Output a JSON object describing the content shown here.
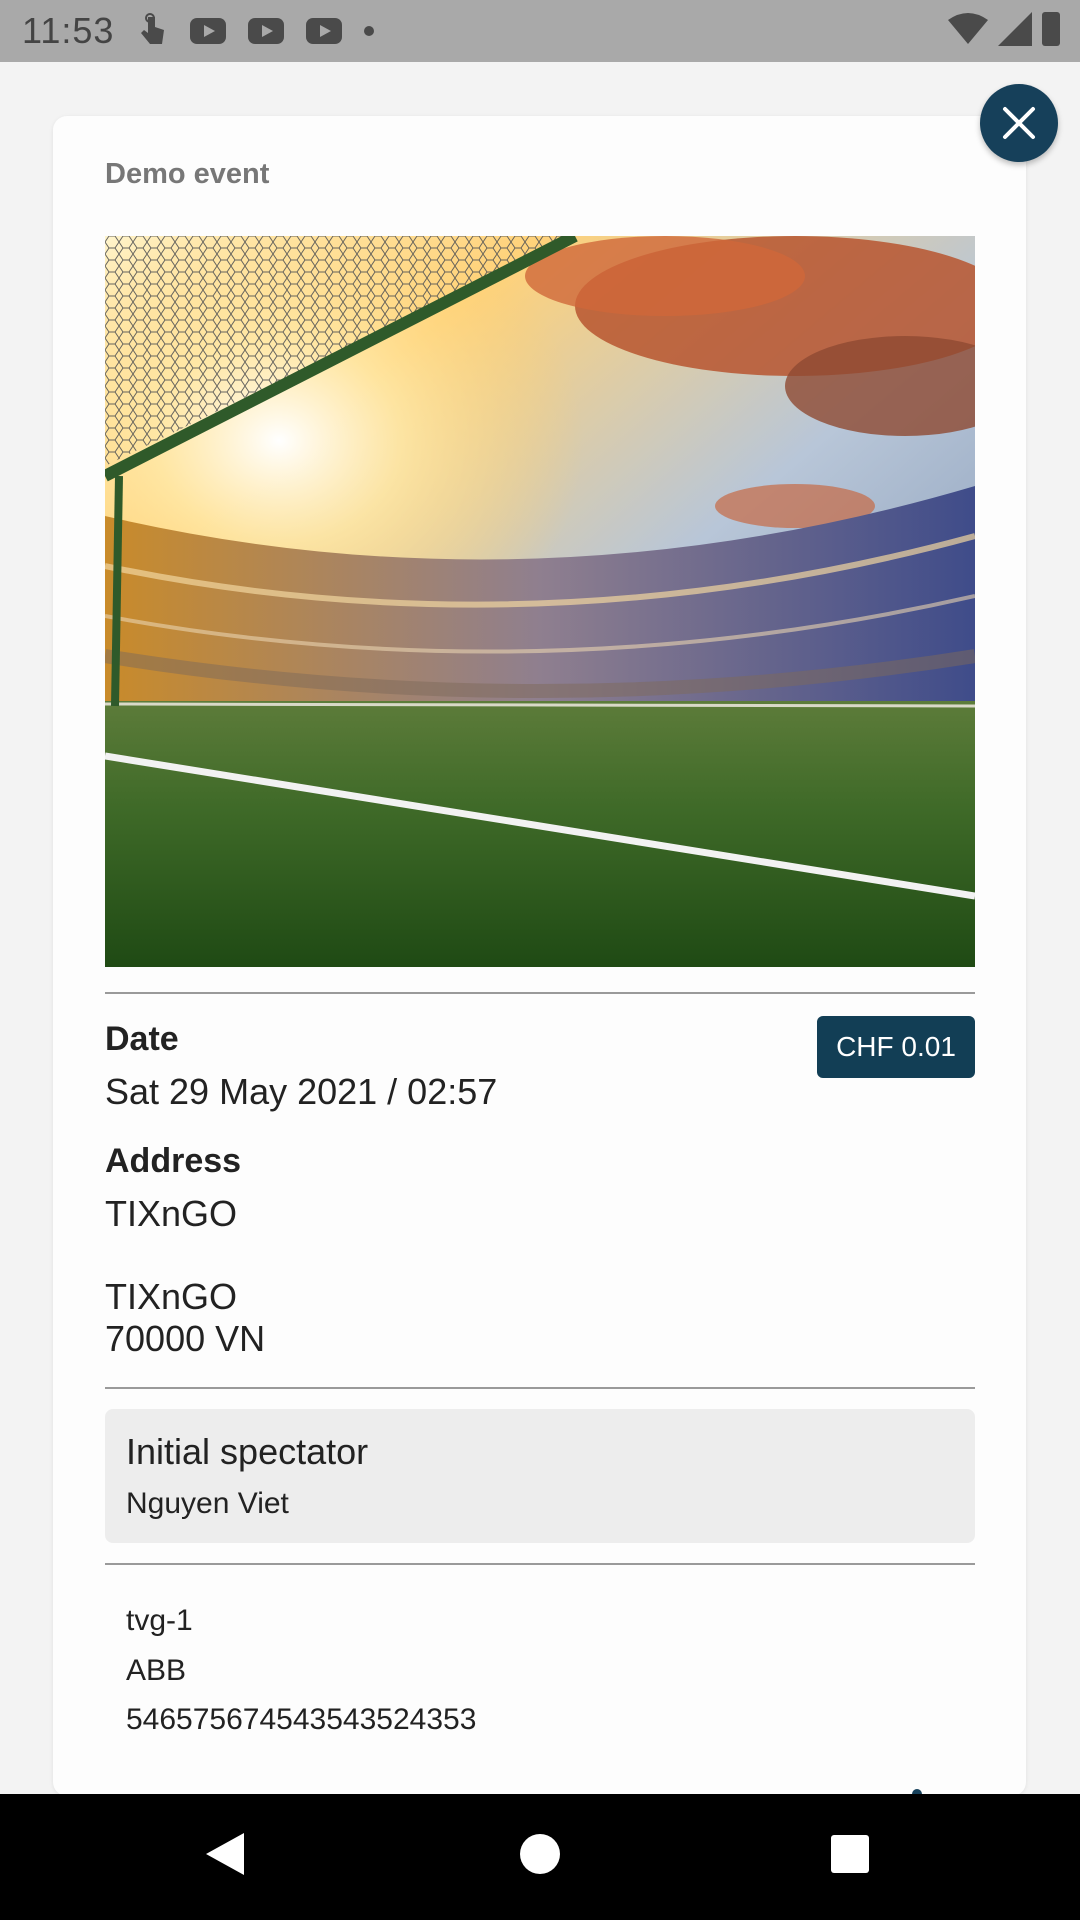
{
  "status_bar": {
    "time": "11:53",
    "icons": [
      "touch-icon",
      "youtube-icon",
      "youtube-icon",
      "youtube-icon",
      "dot-icon",
      "wifi-icon",
      "signal-icon",
      "battery-icon"
    ]
  },
  "event": {
    "name": "Demo event",
    "image": "stadium-image"
  },
  "details": {
    "date_label": "Date",
    "date_value": "Sat 29 May 2021 / 02:57",
    "price": "CHF 0.01",
    "address_label": "Address",
    "address_name": "TIXnGO",
    "address_line1": "TIXnGO",
    "address_line2": "70000 VN"
  },
  "spectator": {
    "title": "Initial spectator",
    "name": "Nguyen Viet"
  },
  "ticket": {
    "lines": [
      "tvg-1",
      "ABB",
      "54657567454354352435​3"
    ]
  },
  "colors": {
    "accent": "#123e55",
    "status_bar": "#a9a9a9",
    "spectator_bg": "#ededed"
  },
  "nav": {
    "back": "back-icon",
    "home": "home-icon",
    "recents": "recents-icon"
  }
}
